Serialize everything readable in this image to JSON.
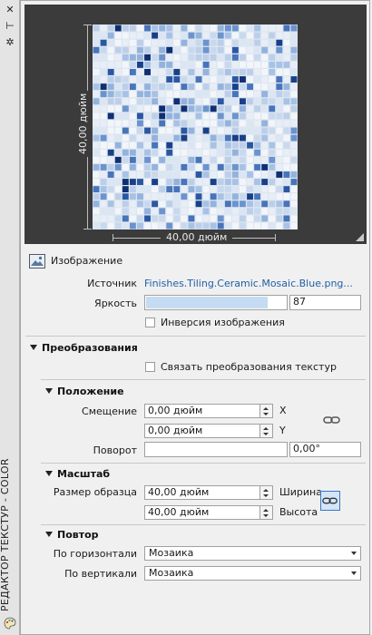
{
  "window": {
    "title": "РЕДАКТОР ТЕКСТУР - COLOR",
    "close_glyph": "✕",
    "pin_glyph": "⊢",
    "settings_glyph": "✲"
  },
  "preview": {
    "width_label": "40,00 дюйм",
    "height_label": "40,00 дюйм",
    "palette": [
      "#f2f6fb",
      "#dbe6f4",
      "#bccfea",
      "#93b3de",
      "#6b93cf",
      "#4774bb",
      "#2a57a3",
      "#18408a",
      "#0e2f73",
      "#c8d9ef",
      "#a7c2e6",
      "#e8eef7"
    ]
  },
  "image_section": {
    "title": "Изображение",
    "source_label": "Источник",
    "source_value": "Finishes.Tiling.Ceramic.Mosaic.Blue.png...",
    "brightness_label": "Яркость",
    "brightness_value": "87",
    "brightness_fraction": 0.87,
    "invert_label": "Инверсия изображения",
    "invert_checked": false
  },
  "transforms": {
    "title": "Преобразования",
    "link_label": "Связать преобразования текстур",
    "link_checked": false
  },
  "position": {
    "title": "Положение",
    "offset_label": "Смещение",
    "offset_x": "0,00 дюйм",
    "offset_y": "0,00 дюйм",
    "x_label": "X",
    "y_label": "Y",
    "rotation_label": "Поворот",
    "rotation_value": "0,00°"
  },
  "scale": {
    "title": "Масштаб",
    "sample_size_label": "Размер образца",
    "width_value": "40,00 дюйм",
    "height_value": "40,00 дюйм",
    "width_label": "Ширина",
    "height_label": "Высота"
  },
  "repeat": {
    "title": "Повтор",
    "horizontal_label": "По горизонтали",
    "horizontal_value": "Мозаика",
    "vertical_label": "По вертикали",
    "vertical_value": "Мозаика"
  }
}
